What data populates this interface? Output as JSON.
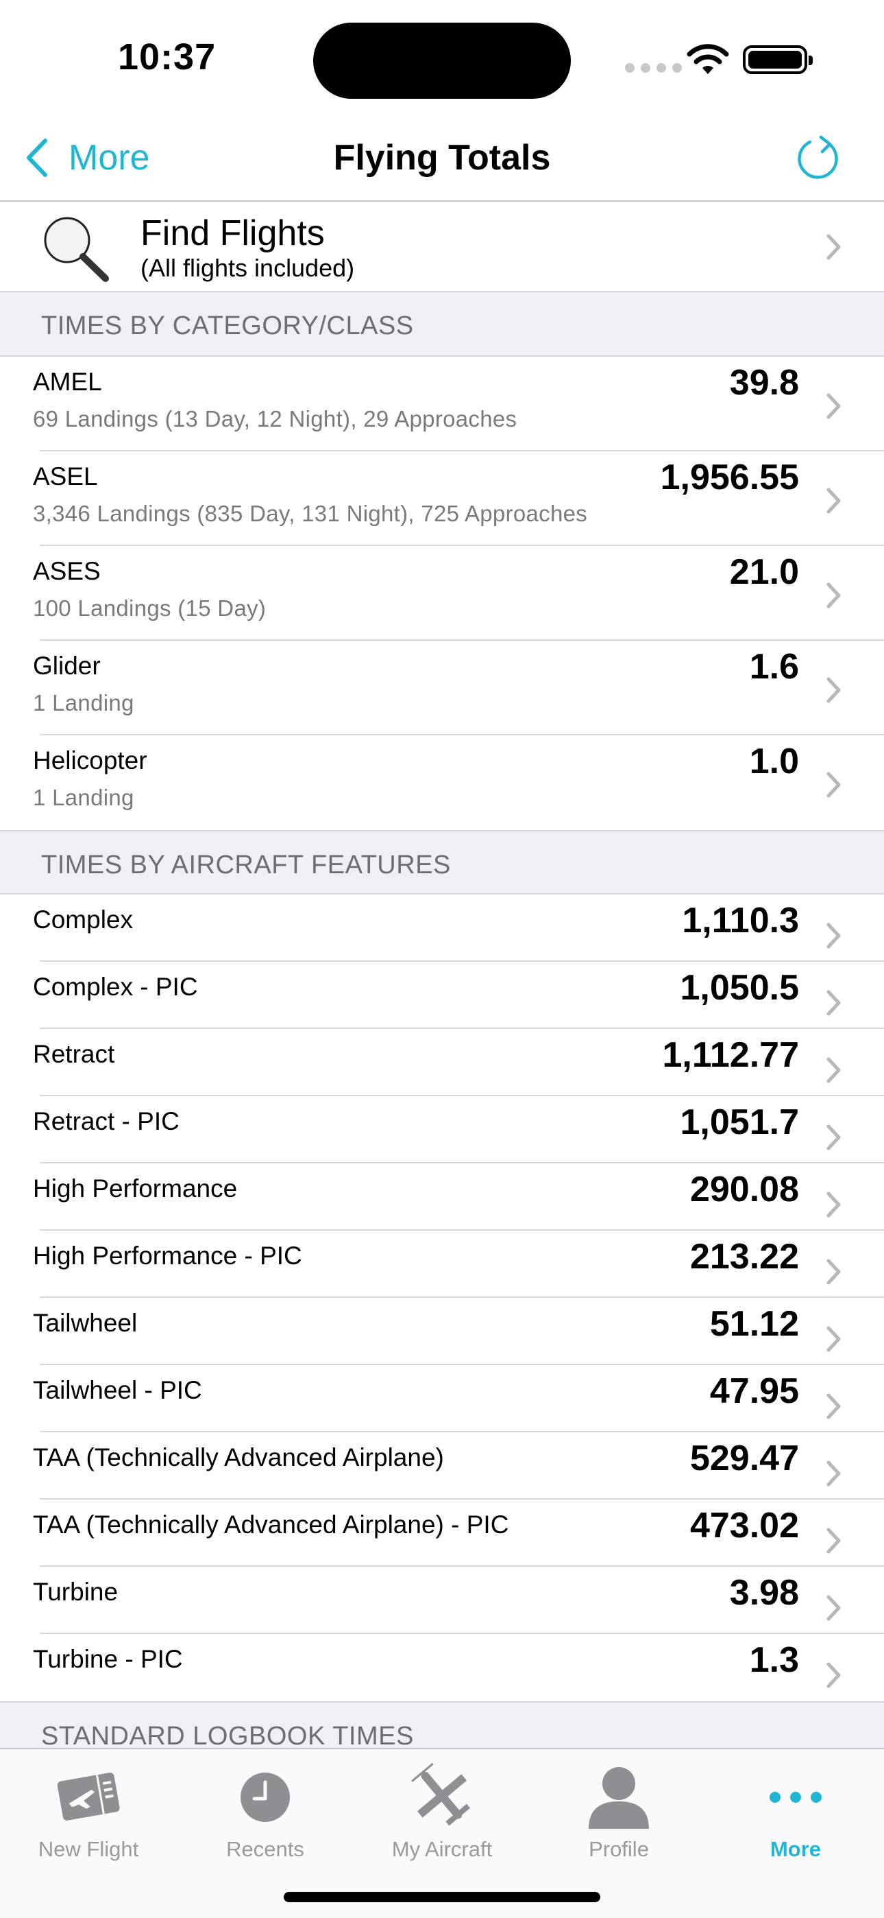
{
  "status_bar": {
    "time": "10:37"
  },
  "nav": {
    "back_label": "More",
    "title": "Flying Totals"
  },
  "find": {
    "title": "Find Flights",
    "subtitle": "(All flights included)"
  },
  "sections": {
    "category": {
      "header": "TIMES BY CATEGORY/CLASS",
      "rows": [
        {
          "label": "AMEL",
          "detail": "69 Landings (13 Day, 12 Night), 29 Approaches",
          "value": "39.8"
        },
        {
          "label": "ASEL",
          "detail": "3,346 Landings (835 Day, 131 Night), 725 Approaches",
          "value": "1,956.55"
        },
        {
          "label": "ASES",
          "detail": "100 Landings (15 Day)",
          "value": "21.0"
        },
        {
          "label": "Glider",
          "detail": "1 Landing",
          "value": "1.6"
        },
        {
          "label": "Helicopter",
          "detail": "1 Landing",
          "value": "1.0"
        }
      ]
    },
    "features": {
      "header": "TIMES BY AIRCRAFT FEATURES",
      "rows": [
        {
          "label": "Complex",
          "value": "1,110.3"
        },
        {
          "label": "Complex - PIC",
          "value": "1,050.5"
        },
        {
          "label": "Retract",
          "value": "1,112.77"
        },
        {
          "label": "Retract - PIC",
          "value": "1,051.7"
        },
        {
          "label": "High Performance",
          "value": "290.08"
        },
        {
          "label": "High Performance - PIC",
          "value": "213.22"
        },
        {
          "label": "Tailwheel",
          "value": "51.12"
        },
        {
          "label": "Tailwheel - PIC",
          "value": "47.95"
        },
        {
          "label": "TAA (Technically Advanced Airplane)",
          "value": "529.47"
        },
        {
          "label": "TAA (Technically Advanced Airplane) - PIC",
          "value": "473.02"
        },
        {
          "label": "Turbine",
          "value": "3.98"
        },
        {
          "label": "Turbine - PIC",
          "value": "1.3"
        }
      ]
    },
    "logbook": {
      "header": "STANDARD LOGBOOK TIMES"
    }
  },
  "tabs": [
    {
      "label": "New Flight",
      "icon": "new-flight-icon",
      "active": false
    },
    {
      "label": "Recents",
      "icon": "clock-icon",
      "active": false
    },
    {
      "label": "My Aircraft",
      "icon": "airplane-icon",
      "active": false
    },
    {
      "label": "Profile",
      "icon": "person-icon",
      "active": false
    },
    {
      "label": "More",
      "icon": "ellipsis-icon",
      "active": true
    }
  ],
  "colors": {
    "accent": "#1fb6d4",
    "section_bg": "#efeff4",
    "secondary_text": "#7a7a7e"
  }
}
